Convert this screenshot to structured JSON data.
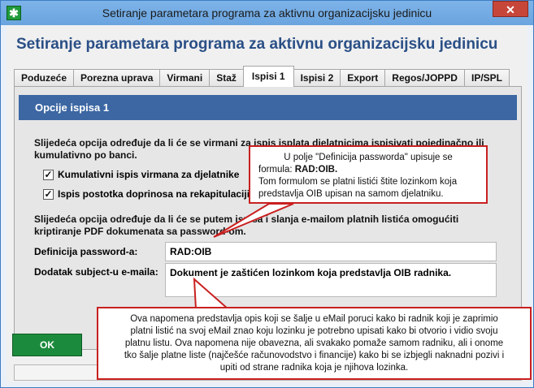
{
  "window": {
    "title": "Setiranje parametara programa za aktivnu organizacijsku jedinicu",
    "close_glyph": "✕",
    "app_icon_glyph": "✱"
  },
  "heading": "Setiranje parametara programa za aktivnu organizacijsku jedinicu",
  "tabs": [
    {
      "label": "Poduzeće",
      "active": false
    },
    {
      "label": "Porezna uprava",
      "active": false
    },
    {
      "label": "Virmani",
      "active": false
    },
    {
      "label": "Staž",
      "active": false
    },
    {
      "label": "Ispisi 1",
      "active": true
    },
    {
      "label": "Ispisi 2",
      "active": false
    },
    {
      "label": "Export",
      "active": false
    },
    {
      "label": "Regos/JOPPD",
      "active": false
    },
    {
      "label": "IP/SPL",
      "active": false
    }
  ],
  "section_title": "Opcije ispisa 1",
  "para1_line1": "Slijedeća opcija određuje da li će se virmani za ispis isplata djelatnicima ispisivati pojedinačno ili",
  "para1_line2": "kumulativno po banci.",
  "checkbox1_label": "Kumulativni ispis virmana za djelatnike",
  "checkbox1_check": "✓",
  "checkbox2_label": "Ispis postotka doprinosa na rekapitulaciji",
  "checkbox2_check": "✓",
  "para2_line1": "Slijedeća opcija određuje da li će se putem ispisa i slanja e-mailom platnih listića omogućiti",
  "para2_line2": "kriptiranje PDF dokumenata sa password-om.",
  "password_label": "Definicija password-a:",
  "password_value": "RAD:OIB",
  "subject_label": "Dodatak subject-u e-maila:",
  "subject_value": "Dokument je zaštićen lozinkom koja predstavlja OIB radnika.",
  "ok_label": "OK",
  "callout1": {
    "line1": "U polje \"Definicija passworda\" upisuje se",
    "line2a": "formula: ",
    "line2b": "RAD:OIB.",
    "line3": "Tom formulom se platni listići štite lozinkom koja",
    "line4": "predstavlja OIB upisan na samom djelatniku."
  },
  "callout2": {
    "line1": "Ova napomena predstavlja opis koji se šalje u eMail poruci kako bi radnik koji je zaprimio",
    "line2": "platni listić na svoj eMail znao koju lozinku je potrebno upisati kako bi otvorio i vidio svoju",
    "line3": "platnu listu. Ova napomena nije obavezna, ali svakako pomaže samom radniku, ali i onome",
    "line4": "tko šalje platne liste (najčešće računovodstvo i financije) kako bi se izbjegli naknadni pozivi i",
    "line5": "upiti od strane radnika koja je njihova lozinka."
  },
  "colors": {
    "heading": "#2a4f86",
    "section_header_bg": "#3c67a3",
    "ok_button_bg": "#1c8a3d",
    "callout_border": "#c92020",
    "close_button_bg": "#c7463a"
  }
}
